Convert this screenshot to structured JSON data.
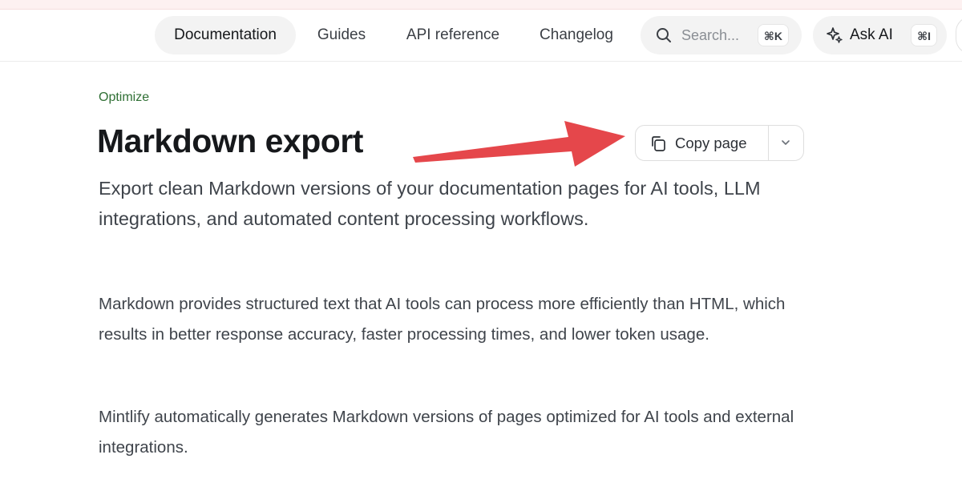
{
  "nav": {
    "tabs": [
      {
        "label": "Documentation",
        "active": true
      },
      {
        "label": "Guides",
        "active": false
      },
      {
        "label": "API reference",
        "active": false
      },
      {
        "label": "Changelog",
        "active": false
      }
    ],
    "search": {
      "placeholder": "Search...",
      "shortcut": "⌘K",
      "icon": "search-icon"
    },
    "ask_ai": {
      "label": "Ask AI",
      "shortcut": "⌘I",
      "icon": "sparkle-icon"
    }
  },
  "page": {
    "eyebrow": "Optimize",
    "title": "Markdown export",
    "subtitle": "Export clean Markdown versions of your documentation pages for AI tools, LLM integrations, and automated content processing workflows.",
    "copy_button": {
      "label": "Copy page",
      "icon": "copy-icon",
      "menu_icon": "chevron-down-icon"
    },
    "paragraphs": [
      "Markdown provides structured text that AI tools can process more efficiently than HTML, which results in better response accuracy, faster processing times, and lower token usage.",
      "Mintlify automatically generates Markdown versions of pages optimized for AI tools and external integrations."
    ]
  },
  "colors": {
    "eyebrow": "#2f6f34",
    "annotation_arrow": "#e5474b",
    "pill_background": "#f3f3f3"
  }
}
